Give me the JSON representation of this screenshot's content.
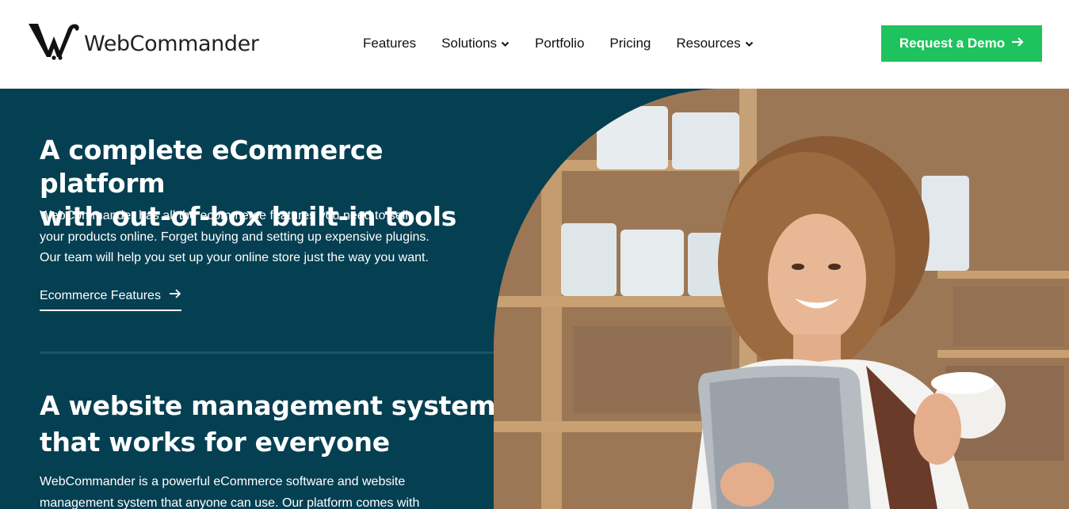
{
  "brand": {
    "name": "WebCommander"
  },
  "nav": {
    "items": [
      {
        "label": "Features",
        "has_dropdown": false
      },
      {
        "label": "Solutions",
        "has_dropdown": true
      },
      {
        "label": "Portfolio",
        "has_dropdown": false
      },
      {
        "label": "Pricing",
        "has_dropdown": false
      },
      {
        "label": "Resources",
        "has_dropdown": true
      }
    ],
    "cta_label": "Request a Demo"
  },
  "hero": {
    "section1": {
      "heading_line1": "A complete eCommerce platform",
      "heading_line2": "with out-of-box built-in tools",
      "para_line1": "WebCommander has all the ecommerce features you need to sell",
      "para_line2": "your products online. Forget buying and setting up expensive plugins.",
      "para_line3": "Our team will help you set up your online store just the way you want.",
      "link_label": "Ecommerce Features"
    },
    "section2": {
      "heading_line1": "A website management system",
      "heading_line2": "that works for everyone",
      "para_line1": "WebCommander is a powerful eCommerce software and website",
      "para_line2": "management system that anyone can use. Our platform comes with"
    }
  },
  "colors": {
    "hero_bg": "#053f52",
    "cta_green": "#1ec35e",
    "text_dark": "#111111"
  },
  "icons": {
    "logo": "webcommander-w-cart-icon",
    "dropdown": "chevron-down-icon",
    "arrow": "arrow-right-icon"
  }
}
